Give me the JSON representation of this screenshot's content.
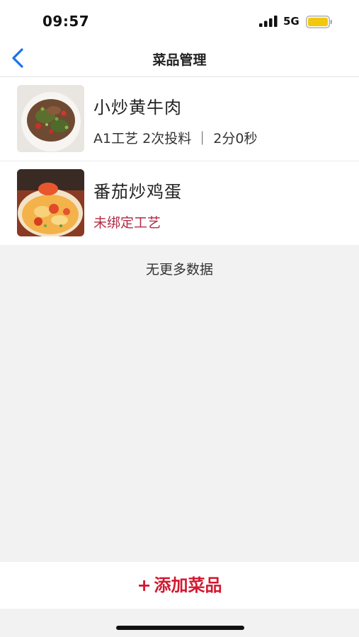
{
  "status_bar": {
    "time": "09:57",
    "network": "5G",
    "signal_icon": "cellular-signal-icon",
    "battery_icon": "battery-icon",
    "battery_color": "#f2c80f"
  },
  "nav": {
    "back_icon": "chevron-left-icon",
    "title": "菜品管理",
    "accent_color": "#1a73e8"
  },
  "dishes": [
    {
      "name": "小炒黄牛肉",
      "detail": "A1工艺 2次投料 ｜ 2分0秒",
      "bound": true
    },
    {
      "name": "番茄炒鸡蛋",
      "detail": "未绑定工艺",
      "bound": false
    }
  ],
  "list_end_text": "无更多数据",
  "footer": {
    "add_icon": "plus-icon",
    "add_plus": "+",
    "add_label": "添加菜品",
    "add_color": "#d3172f"
  }
}
